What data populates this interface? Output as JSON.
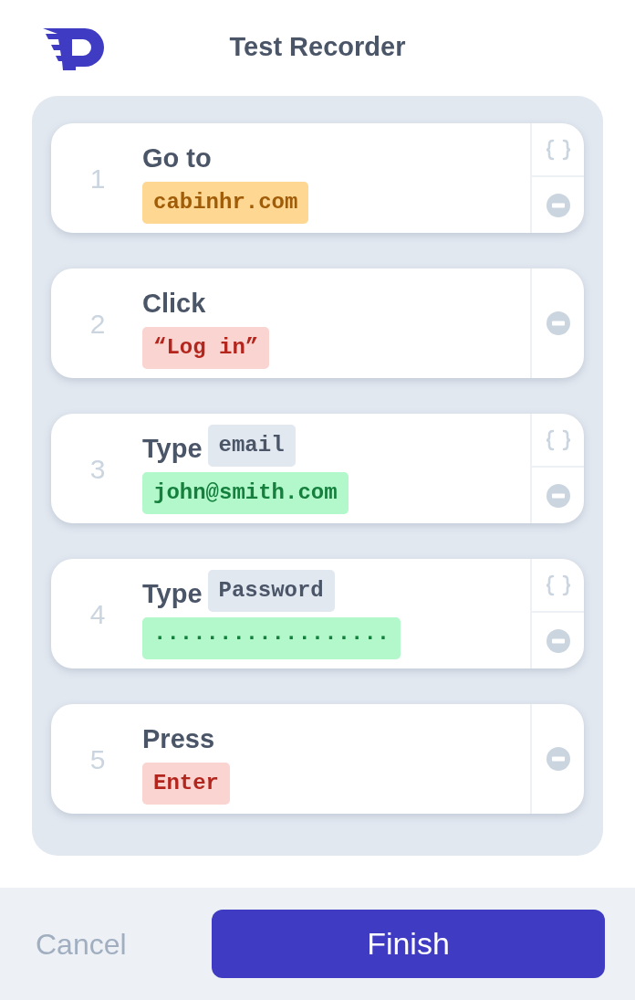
{
  "header": {
    "title": "Test Recorder"
  },
  "steps": [
    {
      "number": "1",
      "action": "Go to",
      "value": "cabinhr.com",
      "kind": "url",
      "variable_button": true
    },
    {
      "number": "2",
      "action": "Click",
      "value": "“Log in”",
      "kind": "target",
      "variable_button": false
    },
    {
      "number": "3",
      "action": "Type",
      "tag": "email",
      "value": "john@smith.com",
      "kind": "text",
      "variable_button": true
    },
    {
      "number": "4",
      "action": "Type",
      "tag": "Password",
      "value": "··················",
      "kind": "text",
      "variable_button": true
    },
    {
      "number": "5",
      "action": "Press",
      "value": "Enter",
      "kind": "key",
      "variable_button": false
    }
  ],
  "footer": {
    "cancel": "Cancel",
    "finish": "Finish"
  }
}
